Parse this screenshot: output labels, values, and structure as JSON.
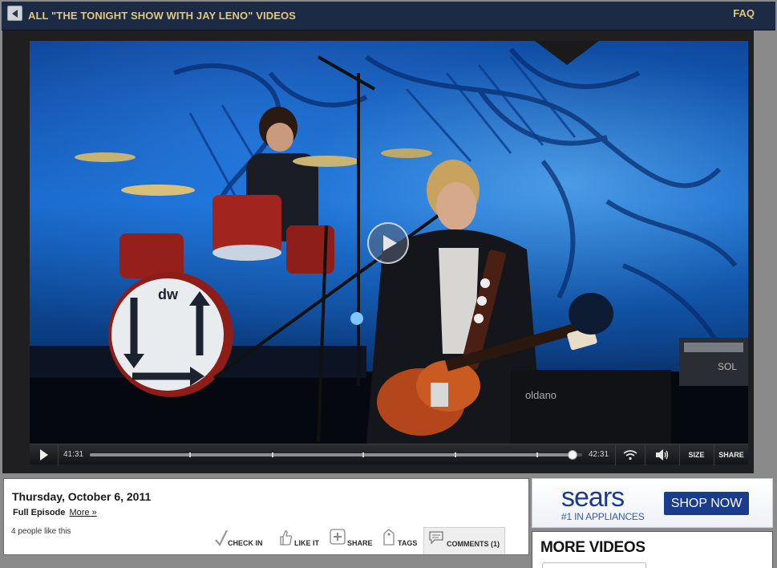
{
  "header": {
    "back_icon": "left-arrow-icon",
    "title": "ALL \"THE TONIGHT SHOW WITH JAY LENO\" VIDEOS",
    "faq_label": "FAQ"
  },
  "player": {
    "elapsed": "41:31",
    "total": "42:31",
    "progress_fraction": 0.98,
    "size_label": "SIZE",
    "share_label": "SHARE",
    "drum_logo": "dw",
    "amp_text": "oldano",
    "amp_badge": "SOL"
  },
  "episode": {
    "date": "Thursday, October 6, 2011",
    "episode_label": "Full Episode",
    "more_label": "More »",
    "likes": "4 people like this",
    "actions": {
      "check_in": "CHECK IN",
      "like_it": "LIKE IT",
      "share": "SHARE",
      "tags": "TAGS",
      "comments": "COMMENTS (1)"
    }
  },
  "ad": {
    "brand": "sears",
    "tagline": "#1 IN APPLIANCES",
    "cta": "SHOP NOW"
  },
  "more_videos": {
    "title": "MORE VIDEOS"
  },
  "colors": {
    "header_bg": "#1c2a44",
    "header_text": "#e0c87a",
    "sears_blue": "#1b3c8c"
  }
}
